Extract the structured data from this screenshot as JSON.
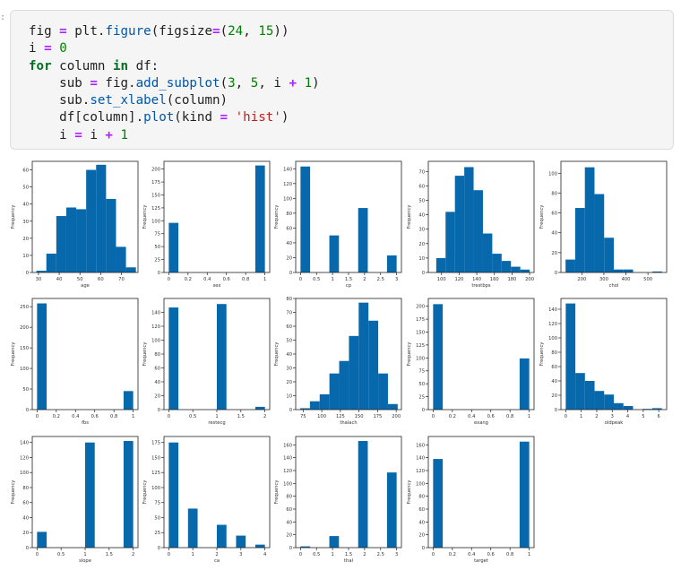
{
  "code_cell": {
    "prompt": ":",
    "lines": [
      [
        {
          "t": "fig "
        },
        {
          "t": "=",
          "c": "o"
        },
        {
          "t": " plt."
        },
        {
          "t": "figure",
          "c": "f"
        },
        {
          "t": "(figsize"
        },
        {
          "t": "=",
          "c": "o"
        },
        {
          "t": "("
        },
        {
          "t": "24",
          "c": "n"
        },
        {
          "t": ", "
        },
        {
          "t": "15",
          "c": "n"
        },
        {
          "t": "))"
        }
      ],
      [
        {
          "t": "i "
        },
        {
          "t": "=",
          "c": "o"
        },
        {
          "t": " "
        },
        {
          "t": "0",
          "c": "n"
        }
      ],
      [
        {
          "t": "for",
          "c": "k"
        },
        {
          "t": " column "
        },
        {
          "t": "in",
          "c": "k"
        },
        {
          "t": " df:"
        }
      ],
      [
        {
          "t": "    sub "
        },
        {
          "t": "=",
          "c": "o"
        },
        {
          "t": " fig."
        },
        {
          "t": "add_subplot",
          "c": "f"
        },
        {
          "t": "("
        },
        {
          "t": "3",
          "c": "n"
        },
        {
          "t": ", "
        },
        {
          "t": "5",
          "c": "n"
        },
        {
          "t": ", i "
        },
        {
          "t": "+",
          "c": "o"
        },
        {
          "t": " "
        },
        {
          "t": "1",
          "c": "n"
        },
        {
          "t": ")"
        }
      ],
      [
        {
          "t": "    sub."
        },
        {
          "t": "set_xlabel",
          "c": "f"
        },
        {
          "t": "(column)"
        }
      ],
      [
        {
          "t": "    df[column]."
        },
        {
          "t": "plot",
          "c": "f"
        },
        {
          "t": "(kind "
        },
        {
          "t": "=",
          "c": "o"
        },
        {
          "t": " "
        },
        {
          "t": "'hist'",
          "c": "s"
        },
        {
          "t": ")"
        }
      ],
      [
        {
          "t": "    i "
        },
        {
          "t": "=",
          "c": "o"
        },
        {
          "t": " i "
        },
        {
          "t": "+",
          "c": "o"
        },
        {
          "t": " "
        },
        {
          "t": "1",
          "c": "n"
        }
      ]
    ]
  },
  "colors": {
    "bar": "#0868ac",
    "axis": "#222222"
  },
  "chart_data": [
    {
      "type": "bar",
      "name": "age",
      "xlabel": "age",
      "ylabel": "Frequency",
      "xlim": [
        27,
        78
      ],
      "xticks": [
        30,
        40,
        50,
        60,
        70
      ],
      "ylim": [
        0,
        65
      ],
      "yticks": [
        0,
        10,
        20,
        30,
        40,
        50,
        60
      ],
      "bins": [
        29,
        33.8,
        38.6,
        43.4,
        48.2,
        53,
        57.8,
        62.6,
        67.4,
        72.2,
        77
      ],
      "values": [
        1,
        11,
        33,
        38,
        37,
        60,
        63,
        43,
        15,
        3
      ]
    },
    {
      "type": "bar",
      "name": "sex",
      "xlabel": "sex",
      "ylabel": "Frequency",
      "xlim": [
        -0.05,
        1.05
      ],
      "xticks": [
        0.0,
        0.2,
        0.4,
        0.6,
        0.8,
        1.0
      ],
      "ylim": [
        0,
        215
      ],
      "yticks": [
        0,
        25,
        50,
        75,
        100,
        125,
        150,
        175,
        200
      ],
      "bins": [
        0,
        0.1,
        0.2,
        0.3,
        0.4,
        0.5,
        0.6,
        0.7,
        0.8,
        0.9,
        1.0
      ],
      "values": [
        96,
        0,
        0,
        0,
        0,
        0,
        0,
        0,
        0,
        207
      ]
    },
    {
      "type": "bar",
      "name": "cp",
      "xlabel": "cp",
      "ylabel": "Frequency",
      "xlim": [
        -0.15,
        3.15
      ],
      "xticks": [
        0.0,
        0.5,
        1.0,
        1.5,
        2.0,
        2.5,
        3.0
      ],
      "ylim": [
        0,
        150
      ],
      "yticks": [
        0,
        20,
        40,
        60,
        80,
        100,
        120,
        140
      ],
      "bins": [
        0,
        0.3,
        0.6,
        0.9,
        1.2,
        1.5,
        1.8,
        2.1,
        2.4,
        2.7,
        3.0
      ],
      "values": [
        143,
        0,
        0,
        50,
        0,
        0,
        87,
        0,
        0,
        23
      ]
    },
    {
      "type": "bar",
      "name": "trestbps",
      "xlabel": "trestbps",
      "ylabel": "Frequency",
      "xlim": [
        85,
        205
      ],
      "xticks": [
        100,
        120,
        140,
        160,
        180,
        200
      ],
      "ylim": [
        0,
        77
      ],
      "yticks": [
        0,
        10,
        20,
        30,
        40,
        50,
        60,
        70
      ],
      "bins": [
        94,
        104.6,
        115.2,
        125.8,
        136.4,
        147,
        157.6,
        168.2,
        178.8,
        189.4,
        200
      ],
      "values": [
        10,
        42,
        67,
        73,
        57,
        27,
        13,
        8,
        4,
        2
      ]
    },
    {
      "type": "bar",
      "name": "chol",
      "xlabel": "chol",
      "ylabel": "Frequency",
      "xlim": [
        105,
        585
      ],
      "xticks": [
        200,
        300,
        400,
        500
      ],
      "ylim": [
        0,
        112
      ],
      "yticks": [
        0,
        20,
        40,
        60,
        80,
        100
      ],
      "bins": [
        126,
        169.8,
        213.6,
        257.4,
        301.2,
        345,
        388.8,
        432.6,
        476.4,
        520.2,
        564
      ],
      "values": [
        13,
        65,
        106,
        79,
        35,
        3,
        3,
        0,
        0,
        1
      ]
    },
    {
      "type": "bar",
      "name": "fbs",
      "xlabel": "fbs",
      "ylabel": "Frequency",
      "xlim": [
        -0.05,
        1.05
      ],
      "xticks": [
        0.0,
        0.2,
        0.4,
        0.6,
        0.8,
        1.0
      ],
      "ylim": [
        0,
        270
      ],
      "yticks": [
        0,
        50,
        100,
        150,
        200,
        250
      ],
      "bins": [
        0,
        0.1,
        0.2,
        0.3,
        0.4,
        0.5,
        0.6,
        0.7,
        0.8,
        0.9,
        1.0
      ],
      "values": [
        258,
        0,
        0,
        0,
        0,
        0,
        0,
        0,
        0,
        45
      ]
    },
    {
      "type": "bar",
      "name": "restecg",
      "xlabel": "restecg",
      "ylabel": "Frequency",
      "xlim": [
        -0.1,
        2.1
      ],
      "xticks": [
        0.0,
        0.5,
        1.0,
        1.5,
        2.0
      ],
      "ylim": [
        0,
        160
      ],
      "yticks": [
        0,
        20,
        40,
        60,
        80,
        100,
        120,
        140
      ],
      "bins": [
        0,
        0.2,
        0.4,
        0.6,
        0.8,
        1.0,
        1.2,
        1.4,
        1.6,
        1.8,
        2.0
      ],
      "values": [
        147,
        0,
        0,
        0,
        0,
        152,
        0,
        0,
        0,
        4
      ]
    },
    {
      "type": "bar",
      "name": "thalach",
      "xlabel": "thalach",
      "ylabel": "Frequency",
      "xlim": [
        65,
        207
      ],
      "xticks": [
        75,
        100,
        125,
        150,
        175,
        200
      ],
      "ylim": [
        0,
        80
      ],
      "yticks": [
        0,
        10,
        20,
        30,
        40,
        50,
        60,
        70,
        80
      ],
      "bins": [
        71,
        84.1,
        97.2,
        110.3,
        123.4,
        136.5,
        149.6,
        162.7,
        175.8,
        188.9,
        202
      ],
      "values": [
        1,
        6,
        11,
        26,
        35,
        53,
        77,
        64,
        26,
        4
      ]
    },
    {
      "type": "bar",
      "name": "exang",
      "xlabel": "exang",
      "ylabel": "Frequency",
      "xlim": [
        -0.05,
        1.05
      ],
      "xticks": [
        0.0,
        0.2,
        0.4,
        0.6,
        0.8,
        1.0
      ],
      "ylim": [
        0,
        215
      ],
      "yticks": [
        0,
        25,
        50,
        75,
        100,
        125,
        150,
        175,
        200
      ],
      "bins": [
        0,
        0.1,
        0.2,
        0.3,
        0.4,
        0.5,
        0.6,
        0.7,
        0.8,
        0.9,
        1.0
      ],
      "values": [
        204,
        0,
        0,
        0,
        0,
        0,
        0,
        0,
        0,
        99
      ]
    },
    {
      "type": "bar",
      "name": "oldpeak",
      "xlabel": "oldpeak",
      "ylabel": "Frequency",
      "xlim": [
        -0.31,
        6.51
      ],
      "xticks": [
        0,
        1,
        2,
        3,
        4,
        5,
        6
      ],
      "ylim": [
        0,
        155
      ],
      "yticks": [
        0,
        20,
        40,
        60,
        80,
        100,
        120,
        140
      ],
      "bins": [
        0,
        0.62,
        1.24,
        1.86,
        2.48,
        3.1,
        3.72,
        4.34,
        4.96,
        5.58,
        6.2
      ],
      "values": [
        148,
        51,
        40,
        26,
        21,
        9,
        5,
        0,
        1,
        2
      ]
    },
    {
      "type": "bar",
      "name": "slope",
      "xlabel": "slope",
      "ylabel": "Frequency",
      "xlim": [
        -0.1,
        2.1
      ],
      "xticks": [
        0.0,
        0.5,
        1.0,
        1.5,
        2.0
      ],
      "ylim": [
        0,
        148
      ],
      "yticks": [
        0,
        20,
        40,
        60,
        80,
        100,
        120,
        140
      ],
      "bins": [
        0,
        0.2,
        0.4,
        0.6,
        0.8,
        1.0,
        1.2,
        1.4,
        1.6,
        1.8,
        2.0
      ],
      "values": [
        21,
        0,
        0,
        0,
        0,
        140,
        0,
        0,
        0,
        142
      ]
    },
    {
      "type": "bar",
      "name": "ca",
      "xlabel": "ca",
      "ylabel": "Frequency",
      "xlim": [
        -0.2,
        4.2
      ],
      "xticks": [
        0,
        1,
        2,
        3,
        4
      ],
      "ylim": [
        0,
        185
      ],
      "yticks": [
        0,
        25,
        50,
        75,
        100,
        125,
        150,
        175
      ],
      "bins": [
        0,
        0.4,
        0.8,
        1.2,
        1.6,
        2.0,
        2.4,
        2.8,
        3.2,
        3.6,
        4.0
      ],
      "values": [
        175,
        0,
        65,
        0,
        0,
        38,
        0,
        20,
        0,
        5
      ]
    },
    {
      "type": "bar",
      "name": "thal",
      "xlabel": "thal",
      "ylabel": "Frequency",
      "xlim": [
        -0.15,
        3.15
      ],
      "xticks": [
        0.0,
        0.5,
        1.0,
        1.5,
        2.0,
        2.5,
        3.0
      ],
      "ylim": [
        0,
        173
      ],
      "yticks": [
        0,
        20,
        40,
        60,
        80,
        100,
        120,
        140,
        160
      ],
      "bins": [
        0,
        0.3,
        0.6,
        0.9,
        1.2,
        1.5,
        1.8,
        2.1,
        2.4,
        2.7,
        3.0
      ],
      "values": [
        2,
        0,
        0,
        18,
        0,
        0,
        166,
        0,
        0,
        117
      ]
    },
    {
      "type": "bar",
      "name": "target",
      "xlabel": "target",
      "ylabel": "Frequency",
      "xlim": [
        -0.05,
        1.05
      ],
      "xticks": [
        0.0,
        0.2,
        0.4,
        0.6,
        0.8,
        1.0
      ],
      "ylim": [
        0,
        173
      ],
      "yticks": [
        0,
        20,
        40,
        60,
        80,
        100,
        120,
        140,
        160
      ],
      "bins": [
        0,
        0.1,
        0.2,
        0.3,
        0.4,
        0.5,
        0.6,
        0.7,
        0.8,
        0.9,
        1.0
      ],
      "values": [
        138,
        0,
        0,
        0,
        0,
        0,
        0,
        0,
        0,
        165
      ]
    }
  ]
}
